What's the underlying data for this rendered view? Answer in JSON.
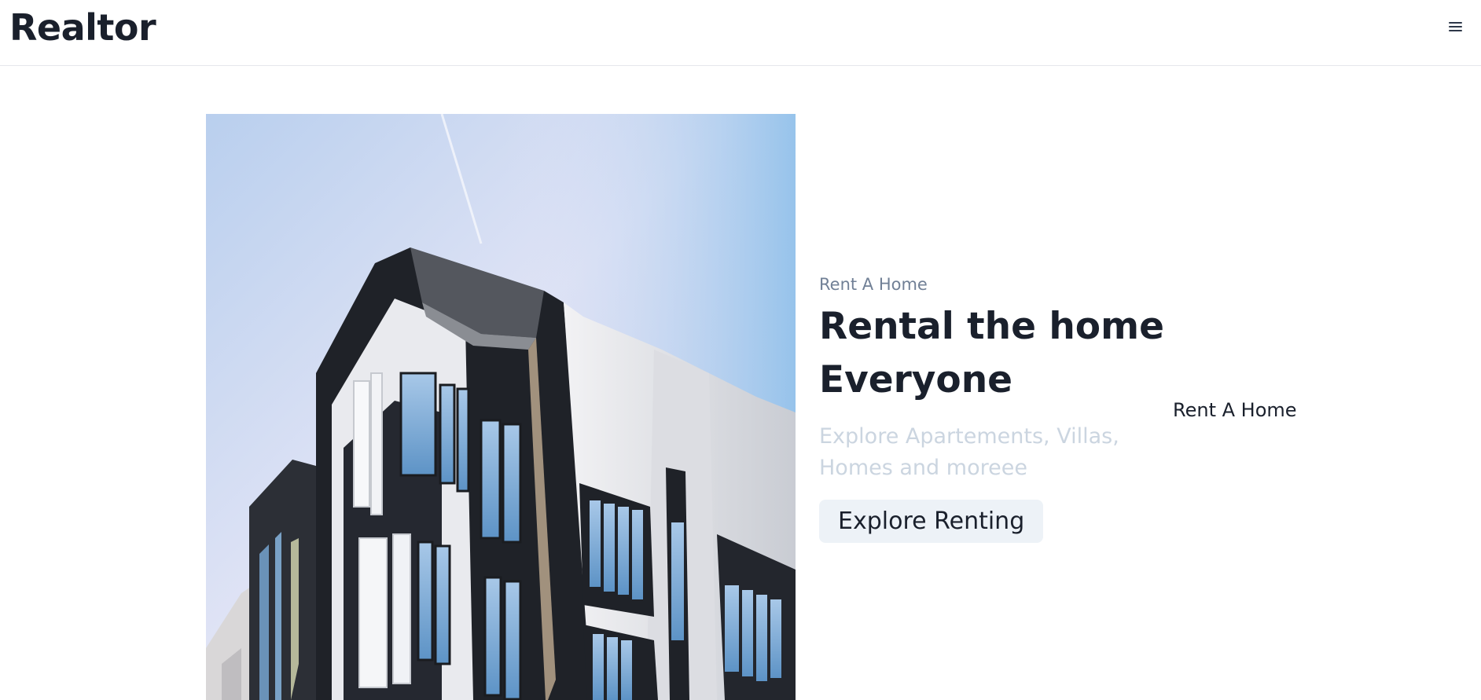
{
  "navbar": {
    "brand": "Realtor",
    "menu_icon": "hamburger-menu-icon"
  },
  "hero": {
    "image_alt": "modern apartment building",
    "eyebrow": "Rent A Home",
    "headline_line1": "Rental the home",
    "headline_line2": "Everyone",
    "subtext": "Explore Apartements, Villas, Homes and moreee",
    "cta_label": "Explore Renting"
  },
  "side_label": "Rent A Home",
  "colors": {
    "text_dark": "#1a202c",
    "text_muted": "#718096",
    "text_light": "#cbd5e0",
    "button_bg": "#edf2f7",
    "sky": "#bcd3f0"
  }
}
